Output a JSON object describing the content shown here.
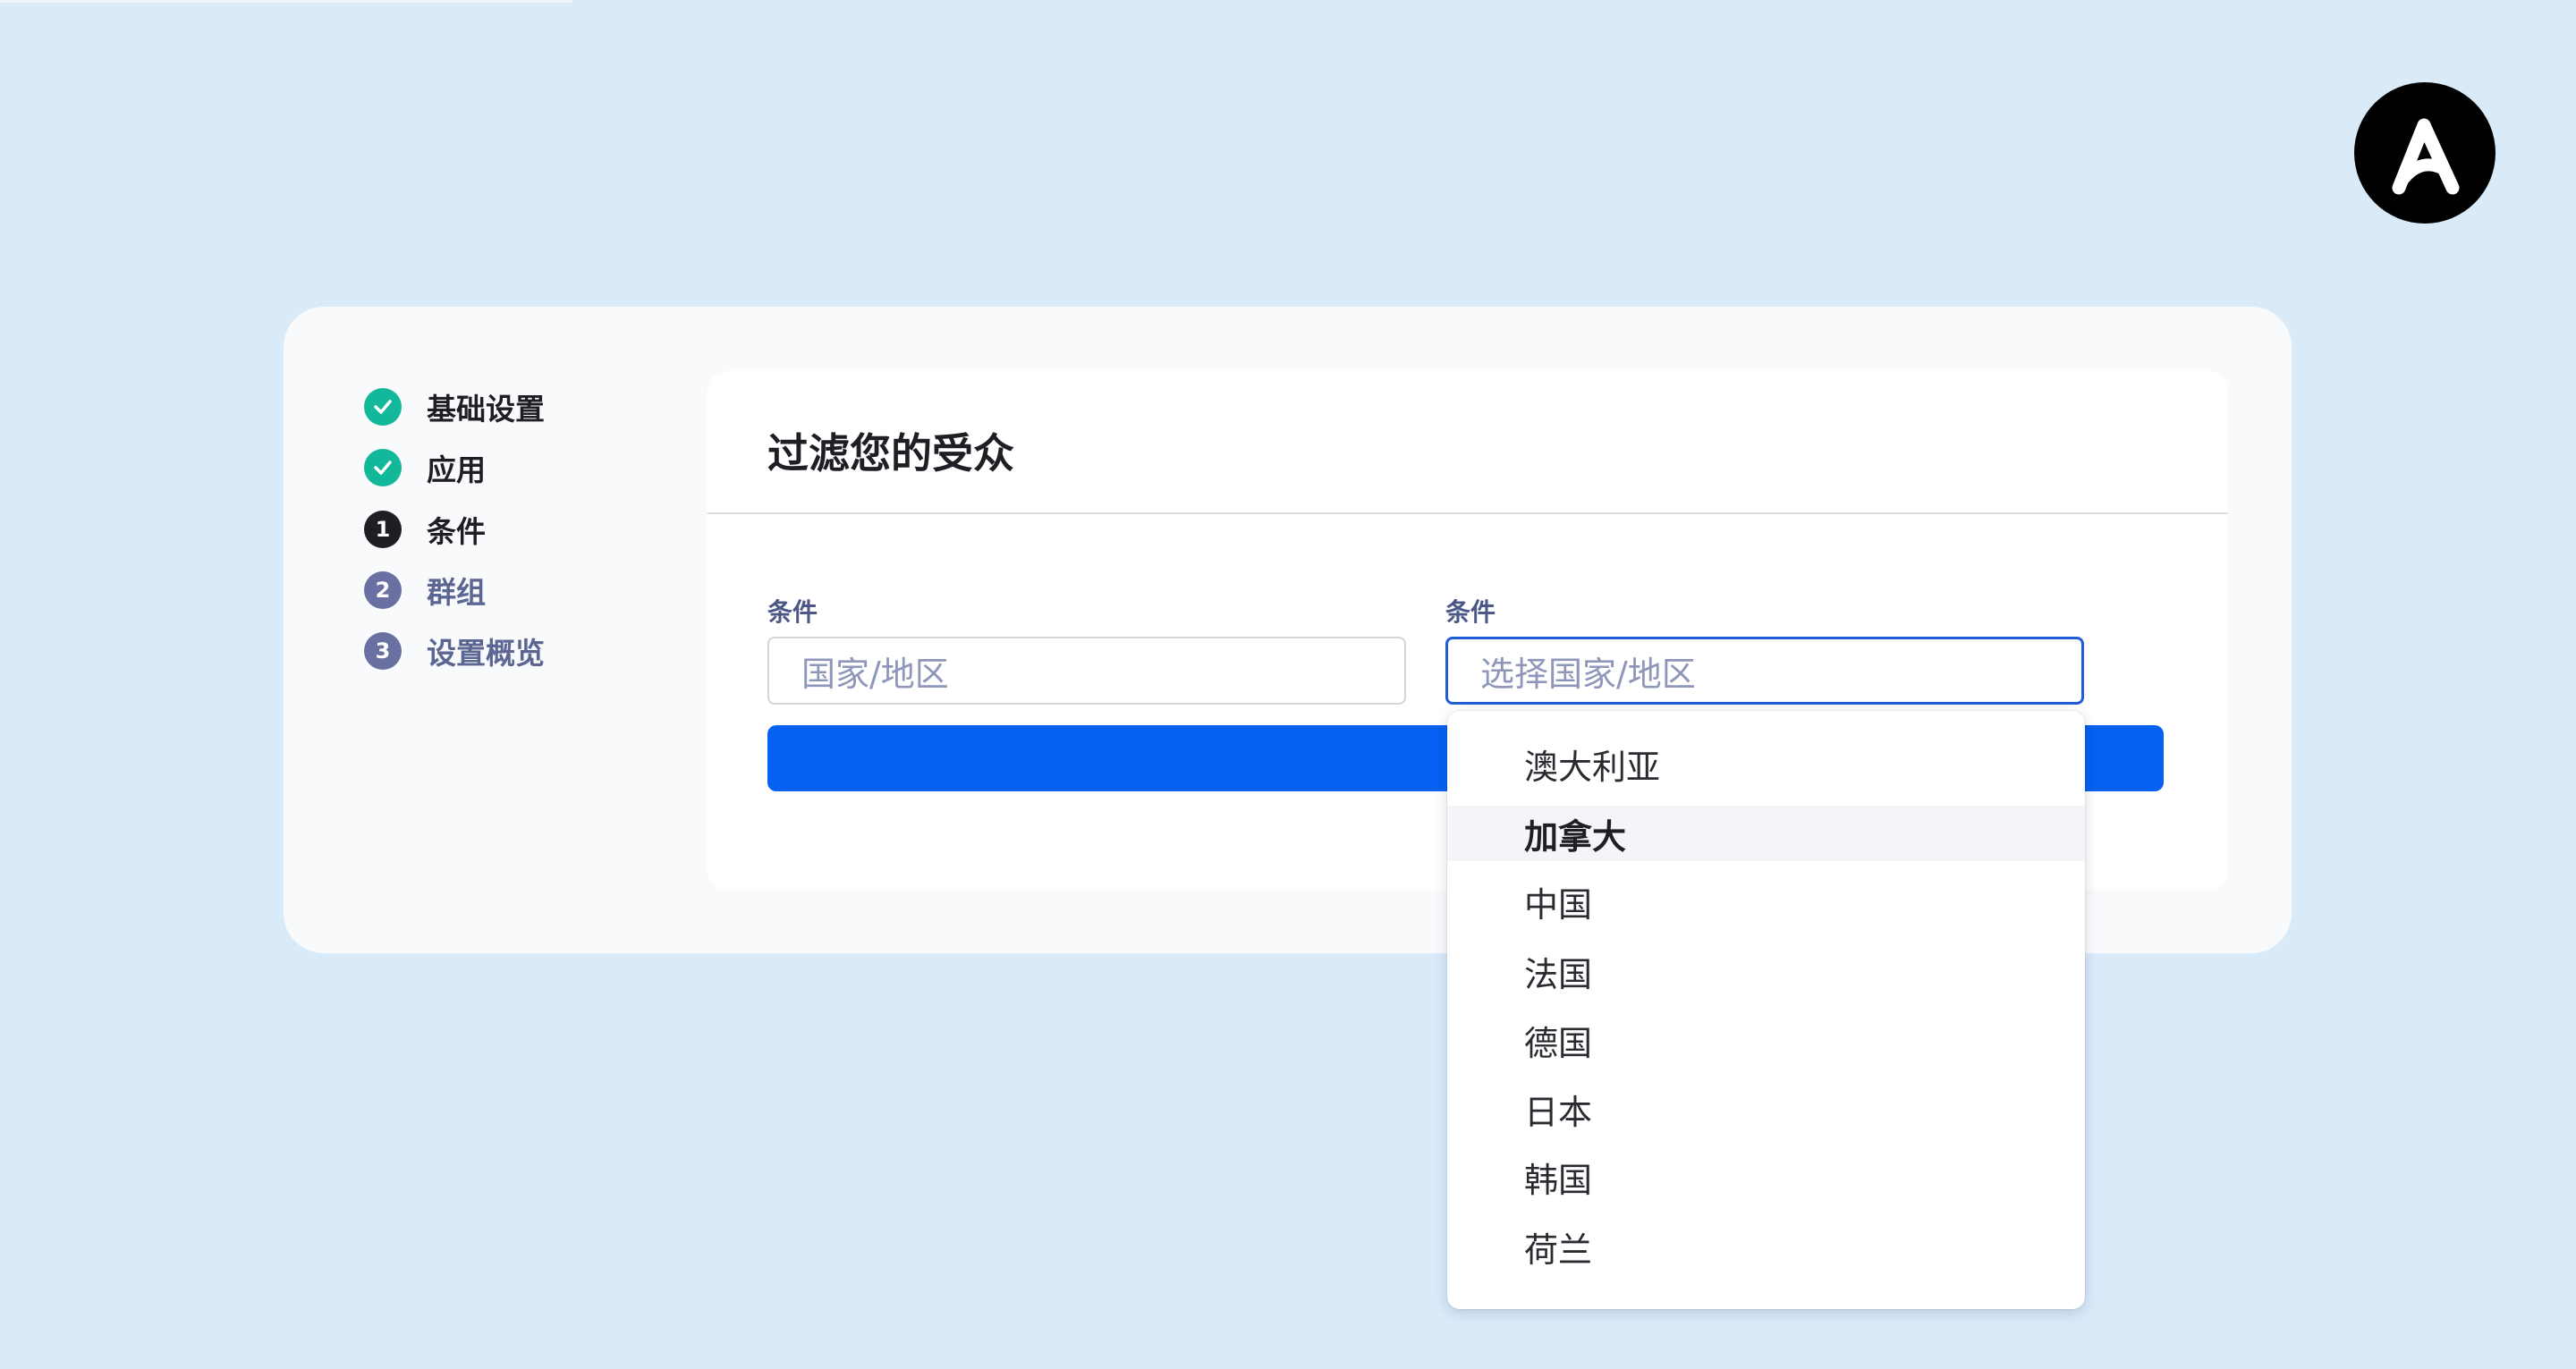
{
  "colors": {
    "background": "#d9ebf9",
    "done": "#13b89a",
    "current": "#1f1f23",
    "pending": "#6a71a2",
    "accent": "#0561f1",
    "focus_border": "#1f5ed6"
  },
  "steps": [
    {
      "label": "基础设置",
      "state": "done",
      "badge": ""
    },
    {
      "label": "应用",
      "state": "done",
      "badge": ""
    },
    {
      "label": "条件",
      "state": "current",
      "badge": "1"
    },
    {
      "label": "群组",
      "state": "pending",
      "badge": "2"
    },
    {
      "label": "设置概览",
      "state": "pending",
      "badge": "3"
    }
  ],
  "panel": {
    "title": "过滤您的受众"
  },
  "fields": [
    {
      "label": "条件",
      "value": "国家/地区"
    },
    {
      "label": "条件",
      "placeholder": "选择国家/地区"
    }
  ],
  "dropdown": {
    "options": [
      "澳大利亚",
      "加拿大",
      "中国",
      "法国",
      "德国",
      "日本",
      "韩国",
      "荷兰"
    ],
    "highlighted_index": 1
  }
}
